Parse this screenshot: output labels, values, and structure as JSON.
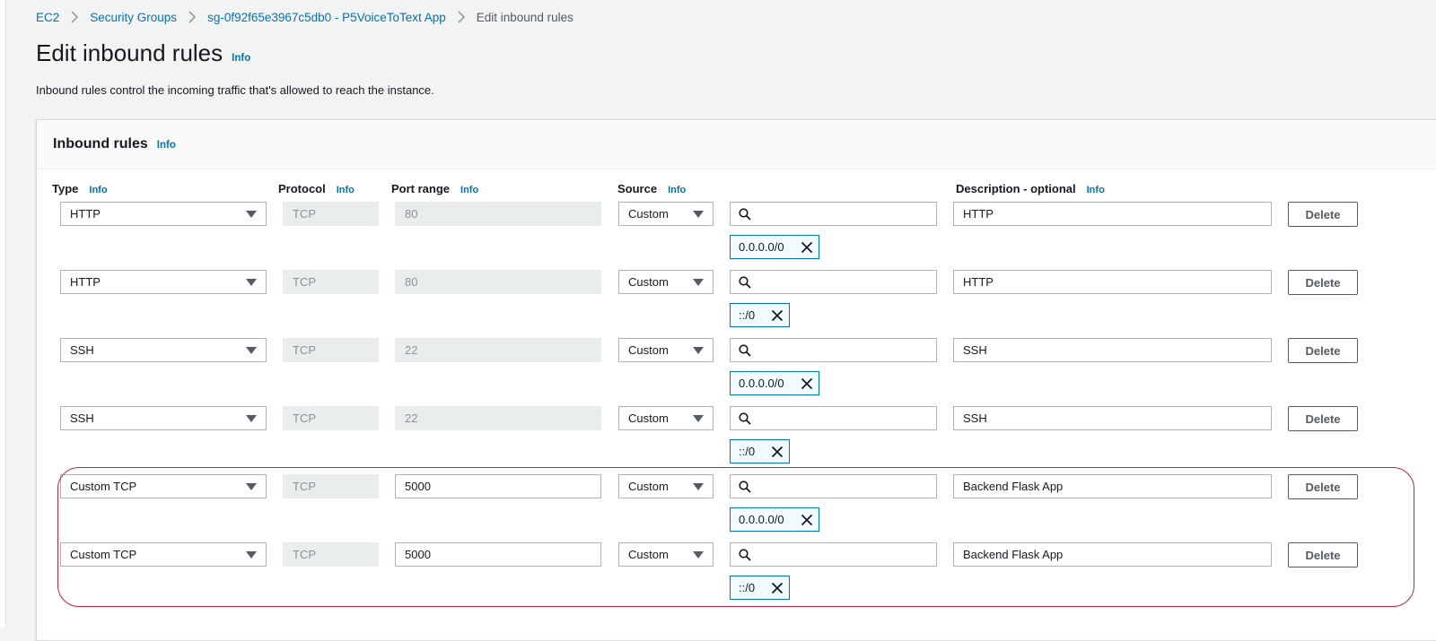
{
  "breadcrumb": {
    "items": [
      "EC2",
      "Security Groups",
      "sg-0f92f65e3967c5db0 - P5VoiceToText App",
      "Edit inbound rules"
    ]
  },
  "page": {
    "title": "Edit inbound rules",
    "info": "Info",
    "description": "Inbound rules control the incoming traffic that's allowed to reach the instance."
  },
  "panel": {
    "title": "Inbound rules",
    "info": "Info"
  },
  "columns": {
    "type": "Type",
    "protocol": "Protocol",
    "port_range": "Port range",
    "source": "Source",
    "description": "Description - optional",
    "info": "Info"
  },
  "rules": [
    {
      "type": "HTTP",
      "protocol": "TCP",
      "port": "80",
      "source": "Custom",
      "cidr": "0.0.0.0/0",
      "description": "HTTP",
      "delete": "Delete"
    },
    {
      "type": "HTTP",
      "protocol": "TCP",
      "port": "80",
      "source": "Custom",
      "cidr": "::/0",
      "description": "HTTP",
      "delete": "Delete"
    },
    {
      "type": "SSH",
      "protocol": "TCP",
      "port": "22",
      "source": "Custom",
      "cidr": "0.0.0.0/0",
      "description": "SSH",
      "delete": "Delete"
    },
    {
      "type": "SSH",
      "protocol": "TCP",
      "port": "22",
      "source": "Custom",
      "cidr": "::/0",
      "description": "SSH",
      "delete": "Delete"
    },
    {
      "type": "Custom TCP",
      "protocol": "TCP",
      "port": "5000",
      "source": "Custom",
      "cidr": "0.0.0.0/0",
      "description": "Backend Flask App",
      "delete": "Delete"
    },
    {
      "type": "Custom TCP",
      "protocol": "TCP",
      "port": "5000",
      "source": "Custom",
      "cidr": "::/0",
      "description": "Backend Flask App",
      "delete": "Delete"
    }
  ],
  "colors": {
    "link": "#0073bb",
    "highlight": "#c3223b",
    "token_border": "#0073bb"
  },
  "icons": [
    "chevron-right-icon",
    "caret-down-icon",
    "search-icon",
    "close-icon"
  ]
}
